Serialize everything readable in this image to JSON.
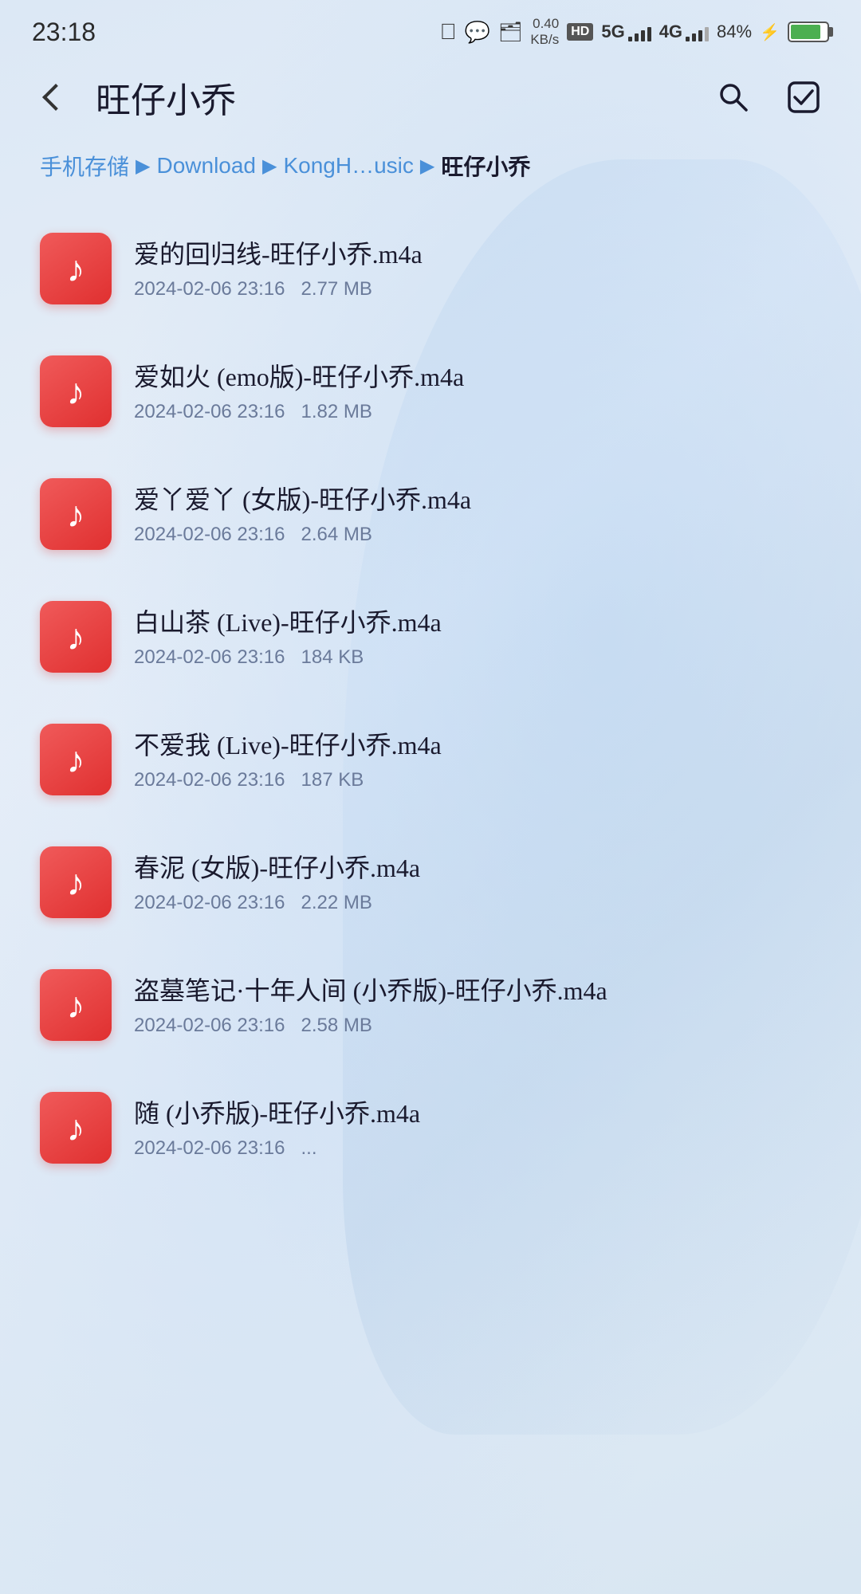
{
  "statusBar": {
    "time": "23:18",
    "speed": "0.40\nKB/s",
    "hd": "HD",
    "net5g": "5G",
    "net4g": "4G",
    "batteryPct": "84%"
  },
  "header": {
    "title": "旺仔小乔",
    "backLabel": "back",
    "searchLabel": "search",
    "checkboxLabel": "select"
  },
  "breadcrumb": {
    "items": [
      {
        "label": "手机存储",
        "active": false
      },
      {
        "label": "Download",
        "active": false
      },
      {
        "label": "KongH…usic",
        "active": false
      },
      {
        "label": "旺仔小乔",
        "active": true
      }
    ],
    "separators": [
      "▶",
      "▶",
      "▶"
    ]
  },
  "files": [
    {
      "name": "爱的回归线-旺仔小乔.m4a",
      "date": "2024-02-06 23:16",
      "size": "2.77 MB"
    },
    {
      "name": "爱如火 (emo版)-旺仔小乔.m4a",
      "date": "2024-02-06 23:16",
      "size": "1.82 MB"
    },
    {
      "name": "爱丫爱丫 (女版)-旺仔小乔.m4a",
      "date": "2024-02-06 23:16",
      "size": "2.64 MB"
    },
    {
      "name": "白山茶 (Live)-旺仔小乔.m4a",
      "date": "2024-02-06 23:16",
      "size": "184 KB"
    },
    {
      "name": "不爱我 (Live)-旺仔小乔.m4a",
      "date": "2024-02-06 23:16",
      "size": "187 KB"
    },
    {
      "name": "春泥 (女版)-旺仔小乔.m4a",
      "date": "2024-02-06 23:16",
      "size": "2.22 MB"
    },
    {
      "name": "盗墓笔记·十年人间 (小乔版)-旺仔小乔.m4a",
      "date": "2024-02-06 23:16",
      "size": "2.58 MB"
    },
    {
      "name": "随 (小乔版)-旺仔小乔.m4a",
      "date": "2024-02-06 23:16",
      "size": "..."
    }
  ]
}
